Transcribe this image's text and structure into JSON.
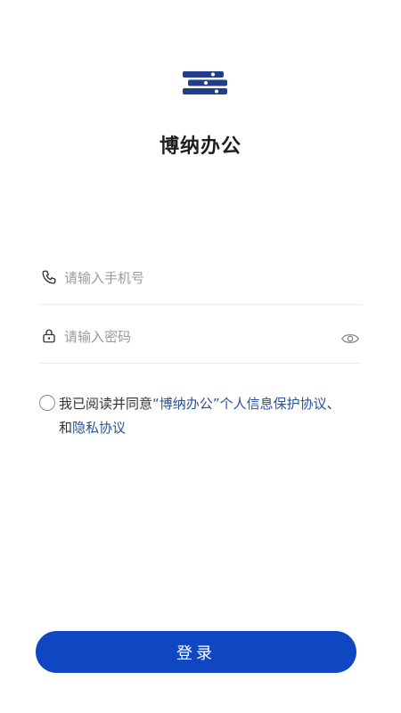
{
  "app": {
    "title": "博纳办公"
  },
  "form": {
    "phone_placeholder": "请输入手机号",
    "password_placeholder": "请输入密码"
  },
  "agreement": {
    "prefix": "我已阅读并同意",
    "quote_open": "“",
    "app_name": "博纳办公",
    "quote_close": "”",
    "privacy_info": "个人信息保护协议",
    "separator": "、",
    "and": "和",
    "privacy_policy": "隐私协议"
  },
  "actions": {
    "login_label": "登录"
  },
  "colors": {
    "brand": "#0f47c2",
    "link": "#2a5296",
    "logo": "#1f3f8c"
  },
  "icons": {
    "logo": "bona-logo-icon",
    "phone": "phone-icon",
    "password": "lock-icon",
    "toggle": "eye-icon",
    "agree": "radio-circle-icon"
  }
}
